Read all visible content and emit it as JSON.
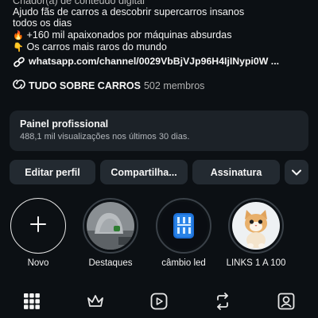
{
  "bio": {
    "cut_line": "Criador(a) de conteúdo digital",
    "line1": "Ajudo fãs de carros a descobrir supercarros insanos",
    "line2": "todos os dias",
    "line3": "+160 mil apaixonados por máquinas absurdas",
    "line4": "Os carros mais raros do mundo",
    "link": "whatsapp.com/channel/0029VbBjVJp96H4IjINypi0W ..."
  },
  "community": {
    "name": "TUDO SOBRE CARROS",
    "members": "502 membros"
  },
  "panel": {
    "title": "Painel profissional",
    "subtitle": "488,1 mil visualizações nos últimos 30 dias."
  },
  "buttons": {
    "edit": "Editar perfil",
    "share": "Compartilha...",
    "subscribe": "Assinatura"
  },
  "highlights": [
    {
      "label": "Novo"
    },
    {
      "label": "Destaques"
    },
    {
      "label": "câmbio led"
    },
    {
      "label": "LINKS 1 A 100"
    }
  ],
  "icons": {
    "fire": "fire-emoji",
    "pointing_down": "backhand-index-pointing-down-emoji",
    "link": "link-icon",
    "community": "community-icon",
    "chevron": "chevron-down-icon",
    "nav": [
      "grid-icon",
      "crown-icon",
      "reels-icon",
      "repost-icon",
      "tagged-icon"
    ]
  },
  "colors": {
    "background": "#0c1014",
    "panel": "#1c2228",
    "button": "#232a31",
    "text": "#f5f5f5"
  }
}
